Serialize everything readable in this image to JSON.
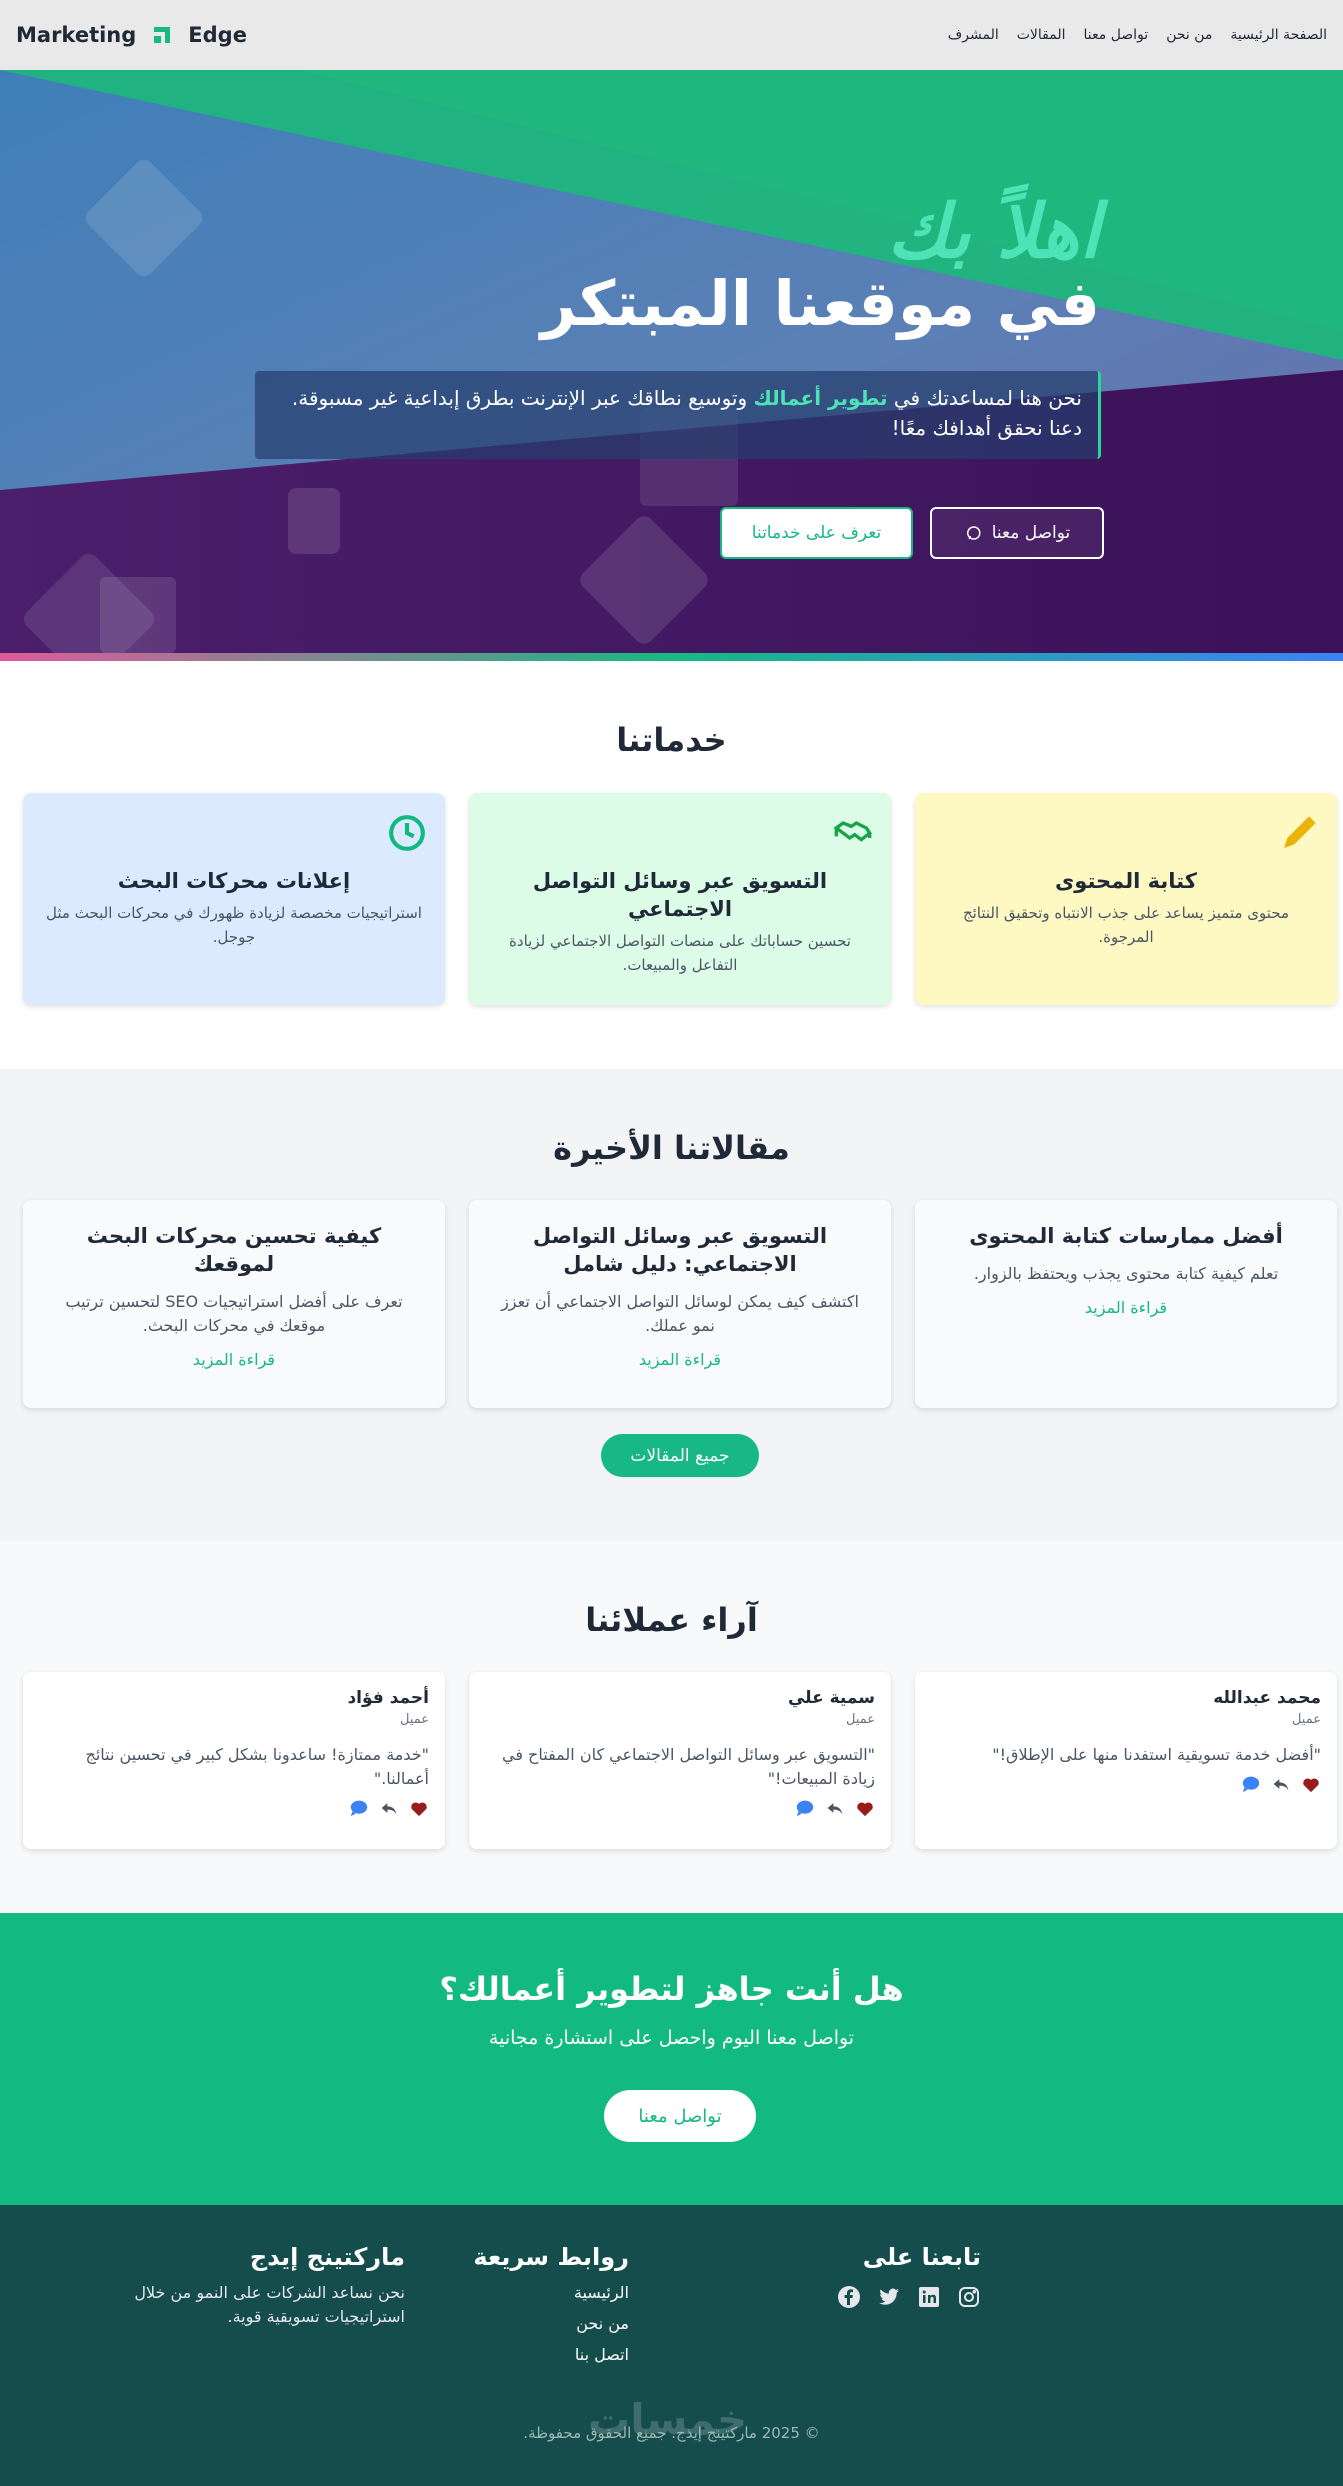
{
  "nav": {
    "brand_left": "Marketing",
    "brand_right": "Edge",
    "links": [
      "الصفحة الرئيسية",
      "من نحن",
      "تواصل معنا",
      "المقالات",
      "المشرف"
    ]
  },
  "hero": {
    "welcome": "اهلاً بك",
    "title": "في موقعنا المبتكر",
    "box_pre": "نحن هنا لمساعدتك في",
    "box_highlight": "تطوير أعمالك",
    "box_post": "وتوسيع نطاقك عبر الإنترنت بطرق إبداعية غير مسبوقة. دعنا نحقق أهدافك معًا!",
    "btn_contact": "تواصل معنا",
    "btn_services": "تعرف على خدماتنا"
  },
  "services": {
    "title": "خدماتنا",
    "items": [
      {
        "icon": "pencil-icon",
        "title": "كتابة المحتوى",
        "desc": "محتوى متميز يساعد على جذب الانتباه وتحقيق النتائج المرجوة.",
        "bg": "#fef9c3",
        "icon_color": "#eab308"
      },
      {
        "icon": "handshake-icon",
        "title": "التسويق عبر وسائل التواصل الاجتماعي",
        "desc": "تحسين حساباتك على منصات التواصل الاجتماعي لزيادة التفاعل والمبيعات.",
        "bg": "#dcfce7",
        "icon_color": "#16a34a"
      },
      {
        "icon": "clock-icon",
        "title": "إعلانات محركات البحث",
        "desc": "استراتيجيات مخصصة لزيادة ظهورك في محركات البحث مثل جوجل.",
        "bg": "#dbeafe",
        "icon_color": "#10b981"
      }
    ]
  },
  "articles": {
    "title": "مقالاتنا الأخيرة",
    "items": [
      {
        "title": "أفضل ممارسات كتابة المحتوى",
        "desc": "تعلم كيفية كتابة محتوى يجذب ويحتفظ بالزوار.",
        "more": "قراءة المزيد"
      },
      {
        "title": "التسويق عبر وسائل التواصل الاجتماعي: دليل شامل",
        "desc": "اكتشف كيف يمكن لوسائل التواصل الاجتماعي أن تعزز نمو عملك.",
        "more": "قراءة المزيد"
      },
      {
        "title": "كيفية تحسين محركات البحث لموقعك",
        "desc": "تعرف على أفضل استراتيجيات SEO لتحسين ترتيب موقعك في محركات البحث.",
        "more": "قراءة المزيد"
      }
    ],
    "all_button": "جميع المقالات"
  },
  "testimonials": {
    "title": "آراء عملائنا",
    "items": [
      {
        "name": "محمد عبدالله",
        "role": "عميل",
        "quote": "\"أفضل خدمة تسويقية استفدنا منها على الإطلاق!\""
      },
      {
        "name": "سمية علي",
        "role": "عميل",
        "quote": "\"التسويق عبر وسائل التواصل الاجتماعي كان المفتاح في زيادة المبيعات!\""
      },
      {
        "name": "أحمد فؤاد",
        "role": "عميل",
        "quote": "\"خدمة ممتازة! ساعدونا بشكل كبير في تحسين نتائج أعمالنا.\""
      }
    ]
  },
  "cta": {
    "title": "هل أنت جاهز لتطوير أعمالك؟",
    "subtitle": "تواصل معنا اليوم واحصل على استشارة مجانية",
    "button": "تواصل معنا"
  },
  "footer": {
    "about_title": "ماركتينج إيدج",
    "about_text": "نحن نساعد الشركات على النمو من خلال استراتيجيات تسويقية قوية.",
    "links_title": "روابط سريعة",
    "links": [
      "الرئيسية",
      "من نحن",
      "اتصل بنا"
    ],
    "follow_title": "تابعنا على",
    "social": [
      "facebook-icon",
      "twitter-icon",
      "linkedin-icon",
      "instagram-icon"
    ],
    "copyright": "© 2025 ماركتينج إيدج. جميع الحقوق محفوظة.",
    "watermark": "خمسات"
  }
}
